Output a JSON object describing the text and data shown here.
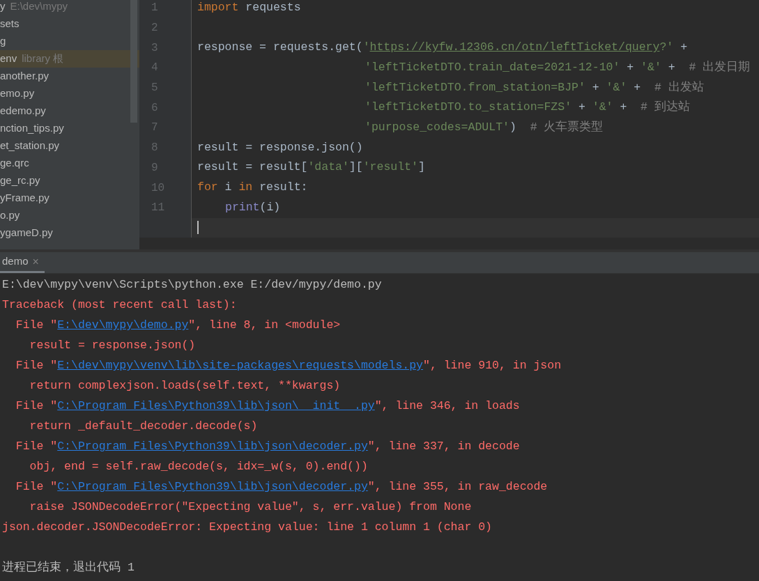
{
  "project_tree": {
    "items": [
      {
        "name": "y",
        "hint": "E:\\dev\\mypy",
        "selected": false
      },
      {
        "name": "sets",
        "selected": false
      },
      {
        "name": "g",
        "selected": false
      },
      {
        "name": "env",
        "hint": "library 根",
        "selected": true
      },
      {
        "name": "another.py",
        "selected": false
      },
      {
        "name": "emo.py",
        "selected": false
      },
      {
        "name": "edemo.py",
        "selected": false
      },
      {
        "name": "nction_tips.py",
        "selected": false
      },
      {
        "name": "et_station.py",
        "selected": false
      },
      {
        "name": "ge.qrc",
        "selected": false
      },
      {
        "name": "ge_rc.py",
        "selected": false
      },
      {
        "name": "yFrame.py",
        "selected": false
      },
      {
        "name": "o.py",
        "selected": false
      },
      {
        "name": "ygameD.py",
        "selected": false
      }
    ]
  },
  "editor": {
    "lines": [
      {
        "number": "1",
        "segments": [
          {
            "kind": "keyword",
            "text": "import"
          },
          {
            "kind": "plain",
            "text": " requests"
          }
        ]
      },
      {
        "number": "2"
      },
      {
        "number": "3",
        "segments": [
          {
            "kind": "plain",
            "text": "response = requests.get("
          },
          {
            "kind": "string",
            "text": "'"
          },
          {
            "kind": "link",
            "text": "https://kyfw.12306.cn/otn/leftTicket/query"
          },
          {
            "kind": "string",
            "text": "?'"
          },
          {
            "kind": "plain",
            "text": " +"
          }
        ]
      },
      {
        "number": "4",
        "kind": "continuation",
        "segments": [
          {
            "kind": "string",
            "text": "'leftTicketDTO.train_date=2021-12-10'"
          },
          {
            "kind": "plain",
            "text": " + "
          },
          {
            "kind": "string",
            "text": "'&'"
          },
          {
            "kind": "plain",
            "text": " +  "
          },
          {
            "kind": "comment",
            "text": "# 出发日期"
          }
        ]
      },
      {
        "number": "5",
        "kind": "continuation",
        "segments": [
          {
            "kind": "string",
            "text": "'leftTicketDTO.from_station=BJP'"
          },
          {
            "kind": "plain",
            "text": " + "
          },
          {
            "kind": "string",
            "text": "'&'"
          },
          {
            "kind": "plain",
            "text": " +  "
          },
          {
            "kind": "comment",
            "text": "# 出发站"
          }
        ]
      },
      {
        "number": "6",
        "kind": "continuation",
        "segments": [
          {
            "kind": "string",
            "text": "'leftTicketDTO.to_station=FZS'"
          },
          {
            "kind": "plain",
            "text": " + "
          },
          {
            "kind": "string",
            "text": "'&'"
          },
          {
            "kind": "plain",
            "text": " +  "
          },
          {
            "kind": "comment",
            "text": "# 到达站"
          }
        ]
      },
      {
        "number": "7",
        "kind": "continuation",
        "segments": [
          {
            "kind": "string",
            "text": "'purpose_codes=ADULT'"
          },
          {
            "kind": "plain",
            "text": ")  "
          },
          {
            "kind": "comment",
            "text": "# 火车票类型"
          }
        ]
      },
      {
        "number": "8",
        "segments": [
          {
            "kind": "plain",
            "text": "result = response.json()"
          }
        ]
      },
      {
        "number": "9",
        "segments": [
          {
            "kind": "plain",
            "text": "result = result["
          },
          {
            "kind": "string",
            "text": "'data'"
          },
          {
            "kind": "plain",
            "text": "]["
          },
          {
            "kind": "string",
            "text": "'result'"
          },
          {
            "kind": "plain",
            "text": "]"
          }
        ]
      },
      {
        "number": "10",
        "segments": [
          {
            "kind": "keyword",
            "text": "for"
          },
          {
            "kind": "plain",
            "text": " i "
          },
          {
            "kind": "keyword",
            "text": "in"
          },
          {
            "kind": "plain",
            "text": " result:"
          }
        ]
      },
      {
        "number": "11",
        "kind": "block",
        "segments": [
          {
            "kind": "builtin",
            "text": "print"
          },
          {
            "kind": "plain",
            "text": "(i)"
          }
        ]
      },
      {
        "current": true
      }
    ]
  },
  "run_panel": {
    "tabs": [
      {
        "label": "demo",
        "selected": true,
        "close": "×"
      }
    ],
    "output": [
      {
        "segments": [
          {
            "kind": "normal",
            "text": "E:\\dev\\mypy\\venv\\Scripts\\python.exe E:/dev/mypy/demo.py"
          }
        ]
      },
      {
        "segments": [
          {
            "kind": "error",
            "text": "Traceback (most recent call last):"
          }
        ]
      },
      {
        "segments": [
          {
            "kind": "error",
            "text": "  File \""
          },
          {
            "kind": "link",
            "text": "E:\\dev\\mypy\\demo.py"
          },
          {
            "kind": "error",
            "text": "\", line 8, in <module>"
          }
        ]
      },
      {
        "segments": [
          {
            "kind": "error",
            "text": "    result = response.json()"
          }
        ]
      },
      {
        "segments": [
          {
            "kind": "error",
            "text": "  File \""
          },
          {
            "kind": "link",
            "text": "E:\\dev\\mypy\\venv\\lib\\site-packages\\requests\\models.py"
          },
          {
            "kind": "error",
            "text": "\", line 910, in json"
          }
        ]
      },
      {
        "segments": [
          {
            "kind": "error",
            "text": "    return complexjson.loads(self.text, **kwargs)"
          }
        ]
      },
      {
        "segments": [
          {
            "kind": "error",
            "text": "  File \""
          },
          {
            "kind": "link",
            "text": "C:\\Program Files\\Python39\\lib\\json\\__init__.py"
          },
          {
            "kind": "error",
            "text": "\", line 346, in loads"
          }
        ]
      },
      {
        "segments": [
          {
            "kind": "error",
            "text": "    return _default_decoder.decode(s)"
          }
        ]
      },
      {
        "segments": [
          {
            "kind": "error",
            "text": "  File \""
          },
          {
            "kind": "link",
            "text": "C:\\Program Files\\Python39\\lib\\json\\decoder.py"
          },
          {
            "kind": "error",
            "text": "\", line 337, in decode"
          }
        ]
      },
      {
        "segments": [
          {
            "kind": "error",
            "text": "    obj, end = self.raw_decode(s, idx=_w(s, 0).end())"
          }
        ]
      },
      {
        "segments": [
          {
            "kind": "error",
            "text": "  File \""
          },
          {
            "kind": "link",
            "text": "C:\\Program Files\\Python39\\lib\\json\\decoder.py"
          },
          {
            "kind": "error",
            "text": "\", line 355, in raw_decode"
          }
        ]
      },
      {
        "segments": [
          {
            "kind": "error",
            "text": "    raise JSONDecodeError(\"Expecting value\", s, err.value) from None"
          }
        ]
      },
      {
        "segments": [
          {
            "kind": "error",
            "text": "json.decoder.JSONDecodeError: Expecting value: line 1 column 1 (char 0)"
          }
        ]
      },
      {
        "gap_before": true,
        "segments": [
          {
            "kind": "normal",
            "text": "进程已结束，退出代码 1"
          }
        ]
      }
    ]
  }
}
